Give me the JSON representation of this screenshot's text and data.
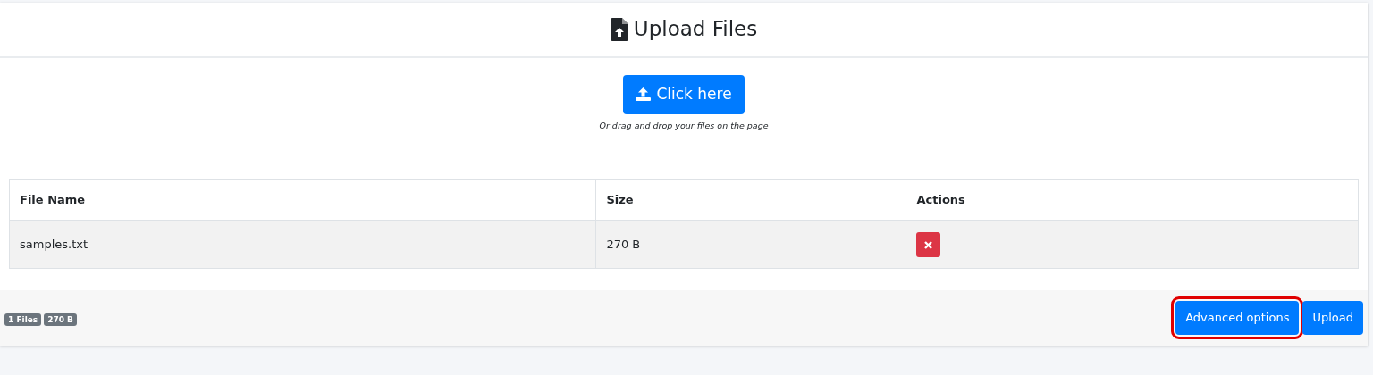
{
  "card": {
    "title": "Upload Files"
  },
  "upload_button": {
    "label": "Click here"
  },
  "hint": "Or drag and drop your files on the page",
  "table": {
    "columns": [
      "File Name",
      "Size",
      "Actions"
    ],
    "rows": [
      {
        "name": "samples.txt",
        "size": "270 B"
      }
    ]
  },
  "footer": {
    "badges": [
      "1 Files",
      "270 B"
    ],
    "buttons": [
      {
        "label": "Advanced options",
        "highlighted": true
      },
      {
        "label": "Upload",
        "highlighted": false
      }
    ]
  }
}
